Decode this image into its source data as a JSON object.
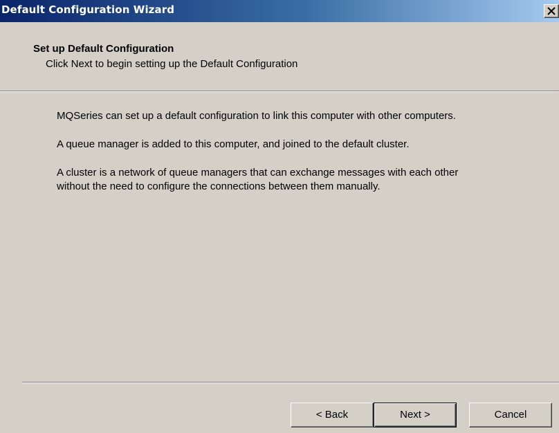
{
  "window": {
    "title": "Default Configuration Wizard",
    "close_glyph": "✕"
  },
  "header": {
    "title": "Set up Default Configuration",
    "subtitle": "Click Next to begin setting up the Default Configuration"
  },
  "content": {
    "paragraphs": [
      "MQSeries can set up a default configuration to link this computer with other computers.",
      "A queue manager is added to this computer, and joined to the default cluster.",
      "A cluster is a network of queue managers that can exchange messages with each other",
      "without the need to configure the connections between them manually."
    ]
  },
  "buttons": {
    "back": "< Back",
    "next": "Next >",
    "cancel": "Cancel"
  },
  "colors": {
    "titlebar_start": "#0a246a",
    "titlebar_end": "#a6caf0",
    "face": "#d4d0c8"
  },
  "icons": {
    "close": "close-icon"
  }
}
